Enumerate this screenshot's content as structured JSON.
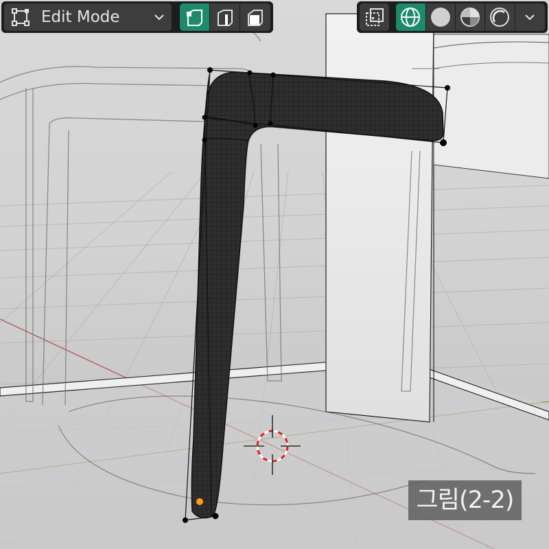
{
  "header": {
    "mode_label": "Edit Mode",
    "mode_icon": "edit-mode-icon",
    "select_modes": [
      "vertex-select-icon",
      "edge-select-icon",
      "face-select-icon"
    ],
    "active_select_mode": "vertex",
    "overlay_toggle_icon": "xray-toggle-icon",
    "shading_modes": [
      "wireframe-shading-icon",
      "solid-shading-icon",
      "material-preview-icon",
      "rendered-shading-icon"
    ],
    "active_shading_mode": "wireframe",
    "shading_dropdown_icon": "chevron-down-icon"
  },
  "caption": {
    "text": "그림(2-2)"
  },
  "colors": {
    "accent": "#1d8a6b",
    "header_bg": "#1d1d1d",
    "button_bg": "#3d3d3d",
    "mesh_dark": "#2b2b2b",
    "x_axis": "#b45a5a",
    "y_axis": "#8ea35e",
    "selected_vertex": "#ff9a1f",
    "cursor_red": "#e02020"
  }
}
